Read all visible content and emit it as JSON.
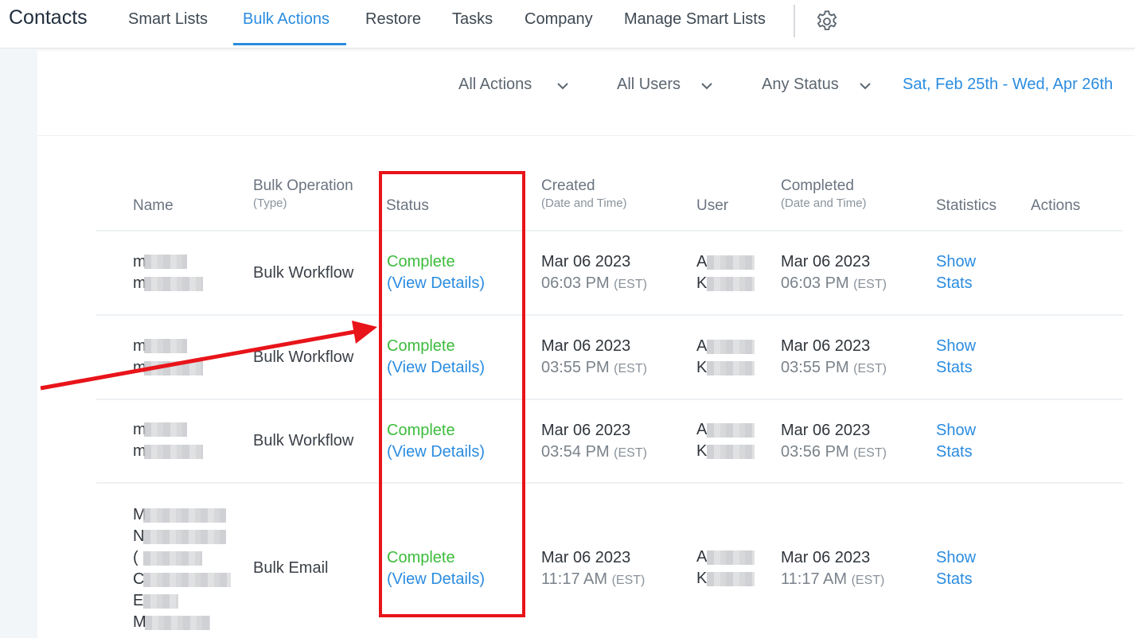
{
  "nav": {
    "brand": "Contacts",
    "tabs": [
      "Smart Lists",
      "Bulk Actions",
      "Restore",
      "Tasks",
      "Company",
      "Manage Smart Lists"
    ],
    "active_tab": "Bulk Actions",
    "settings_icon": "gear-icon"
  },
  "filters": {
    "actions": "All Actions",
    "users": "All Users",
    "status": "Any Status",
    "date_range": "Sat, Feb 25th - Wed, Apr 26th"
  },
  "table": {
    "headers": {
      "name": "Name",
      "bulk_operation": "Bulk Operation",
      "bulk_operation_sub": "(Type)",
      "status": "Status",
      "created": "Created",
      "created_sub": "(Date and Time)",
      "user": "User",
      "completed": "Completed",
      "completed_sub": "(Date and Time)",
      "statistics": "Statistics",
      "actions": "Actions"
    },
    "rows": [
      {
        "name_initials": [
          "m",
          "m"
        ],
        "operation": "Bulk Workflow",
        "status": "Complete",
        "status_link": "(View Details)",
        "created_date": "Mar 06 2023",
        "created_time": "06:03 PM",
        "created_tz": "(EST)",
        "user_initials": [
          "A",
          "K"
        ],
        "completed_date": "Mar 06 2023",
        "completed_time": "06:03 PM",
        "completed_tz": "(EST)",
        "stats_line1": "Show",
        "stats_line2": "Stats"
      },
      {
        "name_initials": [
          "m",
          "m"
        ],
        "operation": "Bulk Workflow",
        "status": "Complete",
        "status_link": "(View Details)",
        "created_date": "Mar 06 2023",
        "created_time": "03:55 PM",
        "created_tz": "(EST)",
        "user_initials": [
          "A",
          "K"
        ],
        "completed_date": "Mar 06 2023",
        "completed_time": "03:55 PM",
        "completed_tz": "(EST)",
        "stats_line1": "Show",
        "stats_line2": "Stats"
      },
      {
        "name_initials": [
          "m",
          "m"
        ],
        "operation": "Bulk Workflow",
        "status": "Complete",
        "status_link": "(View Details)",
        "created_date": "Mar 06 2023",
        "created_time": "03:54 PM",
        "created_tz": "(EST)",
        "user_initials": [
          "A",
          "K"
        ],
        "completed_date": "Mar 06 2023",
        "completed_time": "03:56 PM",
        "completed_tz": "(EST)",
        "stats_line1": "Show",
        "stats_line2": "Stats"
      },
      {
        "name_initials": [
          "M",
          "N",
          "(",
          "C",
          "E",
          "M"
        ],
        "operation": "Bulk Email",
        "status": "Complete",
        "status_link": "(View Details)",
        "created_date": "Mar 06 2023",
        "created_time": "11:17 AM",
        "created_tz": "(EST)",
        "user_initials": [
          "A",
          "K"
        ],
        "completed_date": "Mar 06 2023",
        "completed_time": "11:17 AM",
        "completed_tz": "(EST)",
        "stats_line1": "Show",
        "stats_line2": "Stats"
      }
    ]
  },
  "annotation": {
    "box_color": "#e8141a",
    "arrow_color": "#e8141a"
  },
  "colors": {
    "accent": "#2a8ce0",
    "complete": "#3cbc3c"
  }
}
